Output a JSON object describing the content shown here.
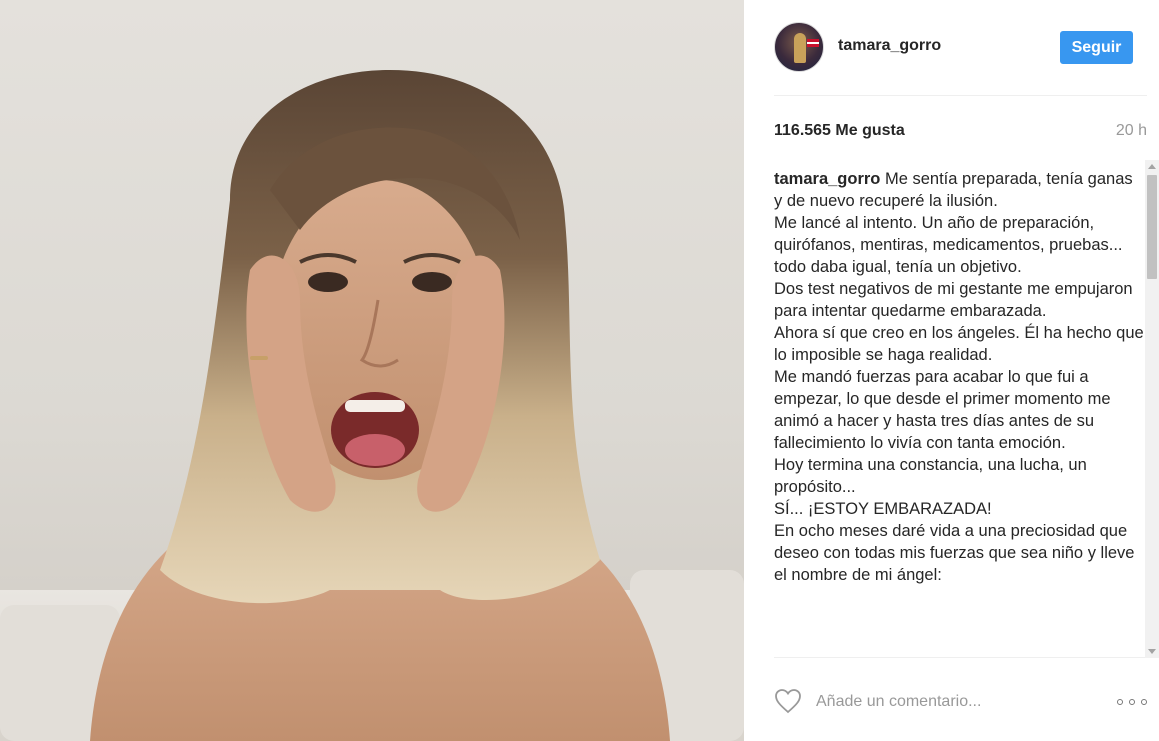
{
  "post": {
    "username": "tamara_gorro",
    "follow_label": "Seguir",
    "likes": "116.565 Me gusta",
    "time_ago": "20 h"
  },
  "caption": {
    "username": "tamara_gorro",
    "lines": [
      "Me sentía preparada, tenía ganas y de nuevo recuperé la ilusión.",
      "Me lancé al intento. Un año de preparación, quirófanos, mentiras, medicamentos, pruebas... todo daba igual, tenía un objetivo.",
      "Dos test negativos de mi gestante me empujaron para intentar quedarme embarazada.",
      "Ahora sí que creo en los ángeles. Él ha hecho que lo imposible se haga realidad.",
      "Me mandó fuerzas para acabar lo que fui a empezar, lo que desde el primer momento me animó a hacer y hasta tres días antes de su fallecimiento lo vivía con tanta emoción.",
      "Hoy termina una constancia, una lucha, un propósito...",
      "SÍ... ¡ESTOY EMBARAZADA!",
      "En ocho meses daré vida a una preciosidad que deseo con todas mis fuerzas que sea niño y lleve el nombre de mi ángel:"
    ]
  },
  "comment": {
    "placeholder": "Añade un comentario..."
  },
  "icons": {
    "like": "heart-outline-icon",
    "more": "more-options-icon"
  },
  "colors": {
    "accent": "#3897f0",
    "muted": "#999999",
    "text": "#262626",
    "divider": "#efefef"
  }
}
